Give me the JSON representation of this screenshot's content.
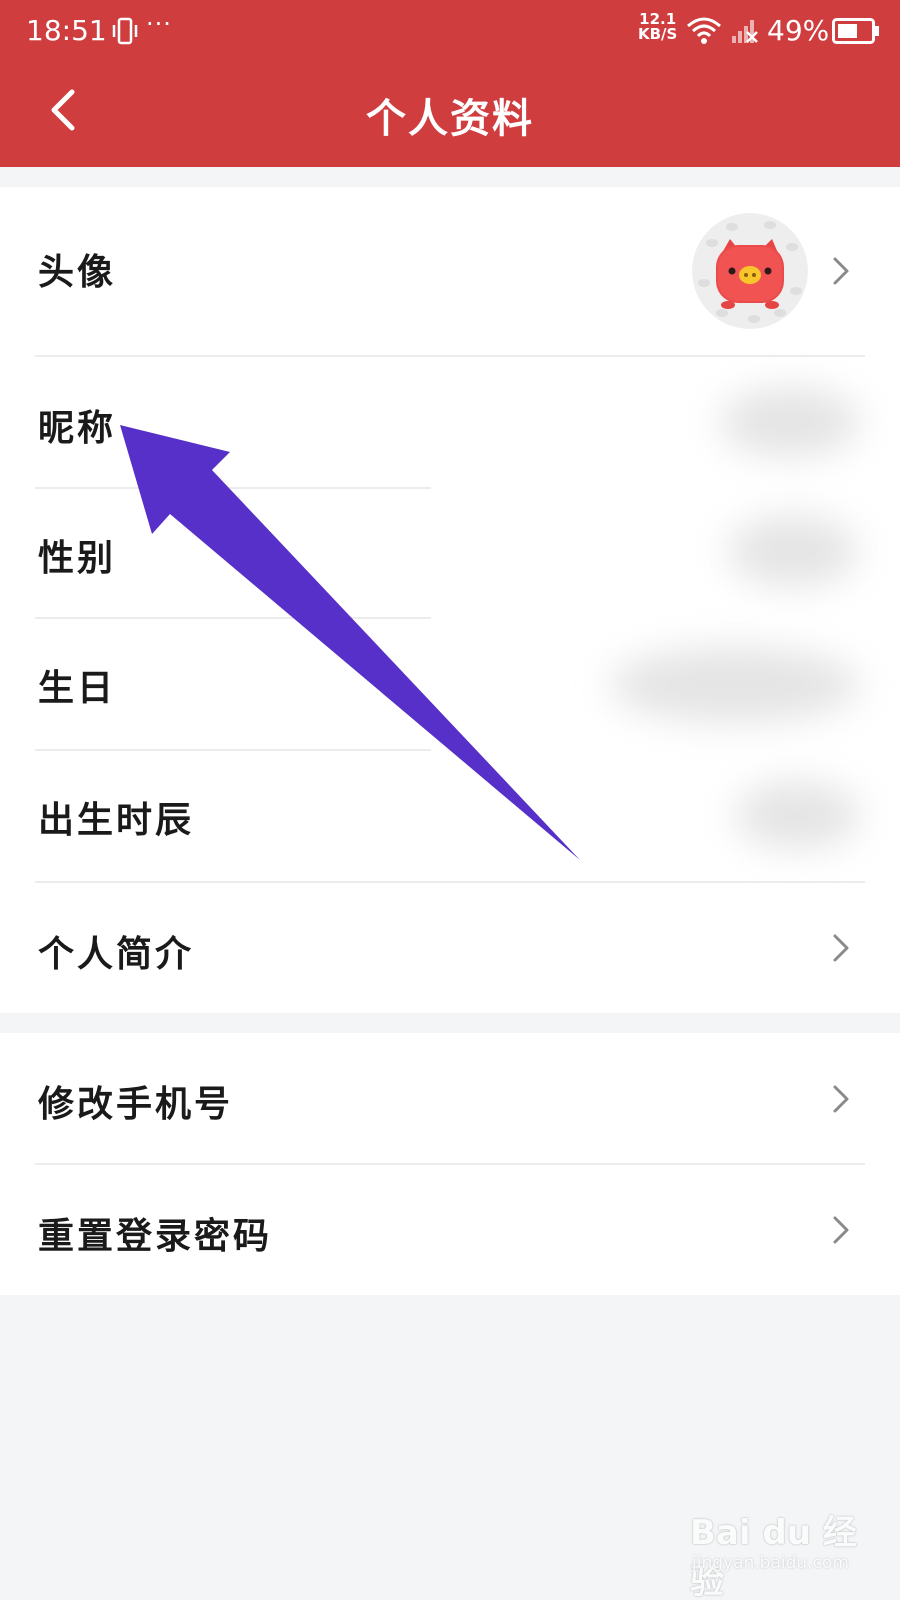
{
  "status_bar": {
    "time": "18:51",
    "more": "···",
    "net_speed_value": "12.1",
    "net_speed_unit": "KB/S",
    "battery": "49%"
  },
  "header": {
    "title": "个人资料",
    "back_icon": "chevron-left-icon"
  },
  "profile_section": {
    "avatar_label": "头像",
    "nickname_label": "昵称",
    "gender_label": "性别",
    "birthday_label": "生日",
    "birth_hour_label": "出生时辰",
    "bio_label": "个人简介"
  },
  "account_section": {
    "change_phone_label": "修改手机号",
    "reset_password_label": "重置登录密码"
  },
  "watermark": {
    "brand": "Bai du 经验",
    "url": "jingyan.baidu.com"
  },
  "colors": {
    "header_red": "#cf3d3f",
    "annotation_arrow": "#5630c9",
    "background": "#f4f5f7"
  }
}
